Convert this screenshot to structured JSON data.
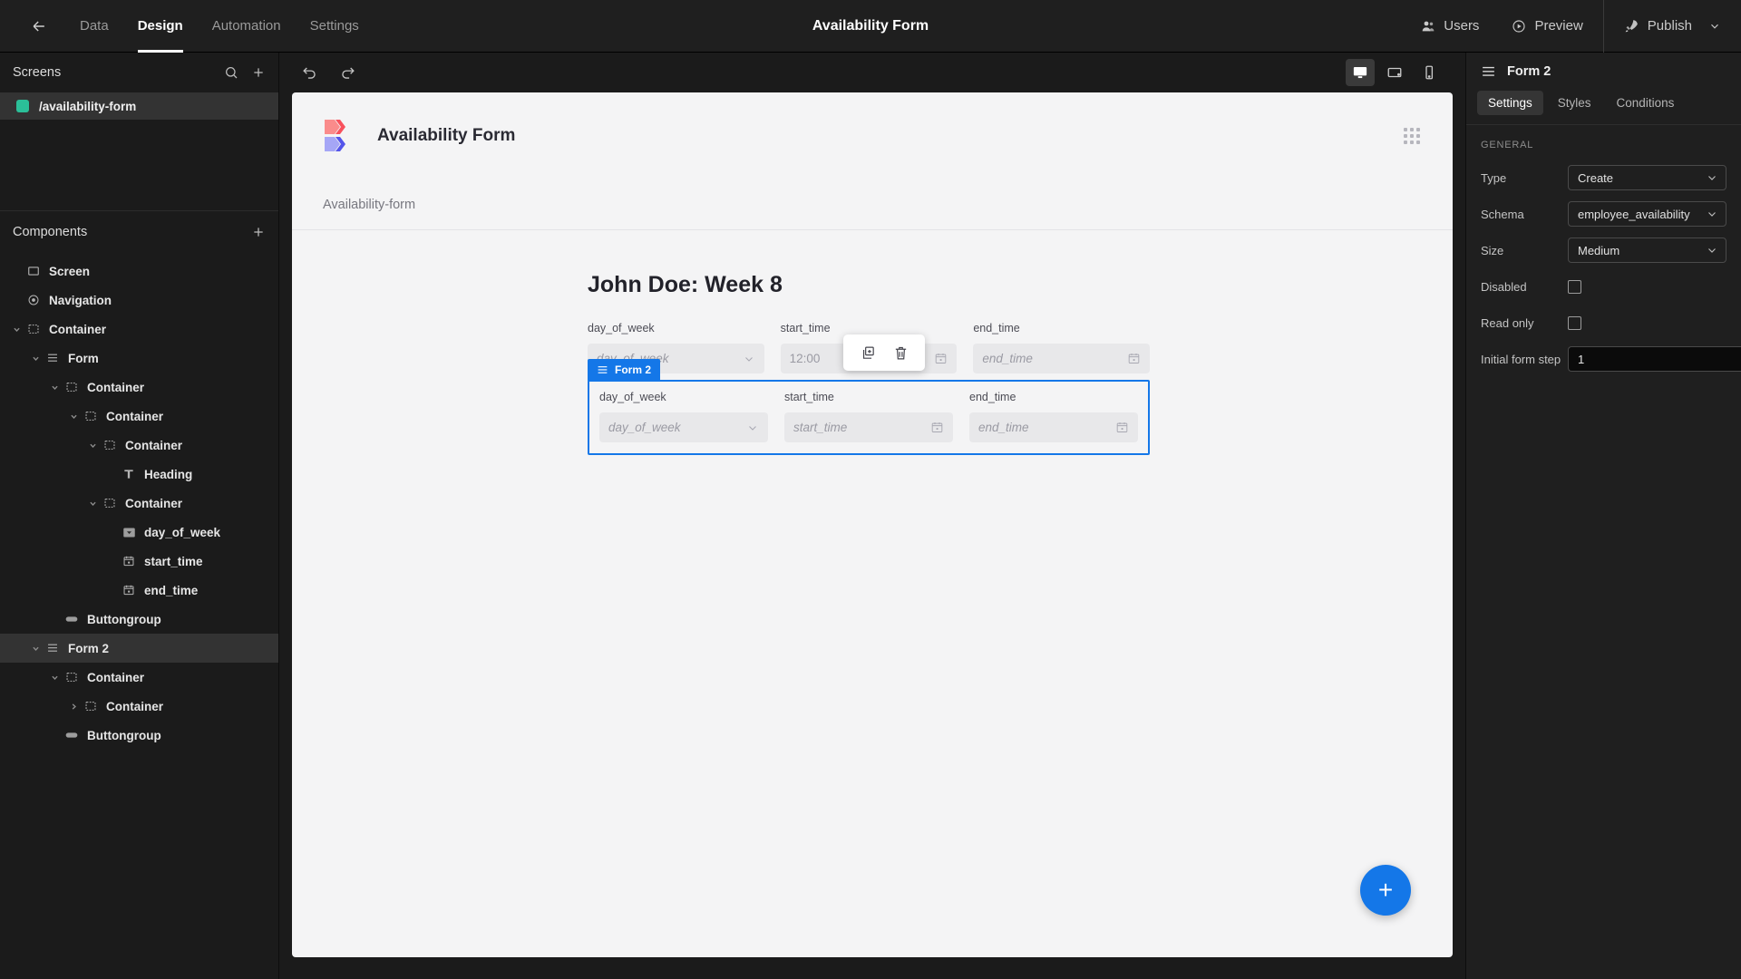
{
  "topbar": {
    "back_icon": "arrow-left-icon",
    "nav_tabs": [
      {
        "label": "Data",
        "active": false
      },
      {
        "label": "Design",
        "active": true
      },
      {
        "label": "Automation",
        "active": false
      },
      {
        "label": "Settings",
        "active": false
      }
    ],
    "title": "Availability Form",
    "users_label": "Users",
    "preview_label": "Preview",
    "publish_label": "Publish"
  },
  "left_panel": {
    "screens": {
      "header": "Screens",
      "search_icon": "search-icon",
      "add_icon": "plus-icon",
      "items": [
        {
          "label": "/availability-form",
          "selected": true,
          "color": "#2bbf98"
        }
      ]
    },
    "components": {
      "header": "Components",
      "add_icon": "plus-icon",
      "tree": [
        {
          "label": "Screen",
          "depth": 0,
          "icon": "screen-icon",
          "caret": "none",
          "selected": false
        },
        {
          "label": "Navigation",
          "depth": 0,
          "icon": "nav-icon",
          "caret": "none",
          "selected": false
        },
        {
          "label": "Container",
          "depth": 0,
          "icon": "container-icon",
          "caret": "expanded",
          "selected": false
        },
        {
          "label": "Form",
          "depth": 1,
          "icon": "form-icon",
          "caret": "expanded",
          "selected": false
        },
        {
          "label": "Container",
          "depth": 2,
          "icon": "container-icon",
          "caret": "expanded",
          "selected": false
        },
        {
          "label": "Container",
          "depth": 3,
          "icon": "container-icon",
          "caret": "expanded",
          "selected": false
        },
        {
          "label": "Container",
          "depth": 4,
          "icon": "container-icon",
          "caret": "expanded",
          "selected": false
        },
        {
          "label": "Heading",
          "depth": 5,
          "icon": "text-icon",
          "caret": "none",
          "selected": false
        },
        {
          "label": "Container",
          "depth": 4,
          "icon": "container-icon",
          "caret": "expanded",
          "selected": false
        },
        {
          "label": "day_of_week",
          "depth": 5,
          "icon": "select-icon",
          "caret": "none",
          "selected": false
        },
        {
          "label": "start_time",
          "depth": 5,
          "icon": "calendar-icon",
          "caret": "none",
          "selected": false
        },
        {
          "label": "end_time",
          "depth": 5,
          "icon": "calendar-icon",
          "caret": "none",
          "selected": false
        },
        {
          "label": "Buttongroup",
          "depth": 2,
          "icon": "button-icon",
          "caret": "none",
          "selected": false
        },
        {
          "label": "Form 2",
          "depth": 1,
          "icon": "form-icon",
          "caret": "expanded",
          "selected": true
        },
        {
          "label": "Container",
          "depth": 2,
          "icon": "container-icon",
          "caret": "expanded",
          "selected": false
        },
        {
          "label": "Container",
          "depth": 3,
          "icon": "container-icon",
          "caret": "collapsed",
          "selected": false
        },
        {
          "label": "Buttongroup",
          "depth": 2,
          "icon": "button-icon",
          "caret": "none",
          "selected": false
        }
      ]
    }
  },
  "canvas": {
    "undo_icon": "undo-icon",
    "redo_icon": "redo-icon",
    "devices": [
      {
        "name": "desktop-view",
        "icon": "desktop-icon",
        "active": true
      },
      {
        "name": "tablet-view",
        "icon": "tablet-icon",
        "active": false
      },
      {
        "name": "mobile-view",
        "icon": "mobile-icon",
        "active": false
      }
    ],
    "app_title": "Availability Form",
    "logo_colors": {
      "top_left": "#fa8b8b",
      "top_right": "#f8515c",
      "bottom_left": "#a5a6f6",
      "bottom_right": "#5455ea"
    },
    "grid_icon": "grid-dots-icon",
    "breadcrumb": "Availability-form",
    "form_heading": "John Doe: Week 8",
    "form1": {
      "fields": [
        {
          "label": "day_of_week",
          "value": "day_of_week",
          "is_placeholder": true,
          "control": "select"
        },
        {
          "label": "start_time",
          "value": "12:00",
          "is_placeholder": false,
          "control": "date"
        },
        {
          "label": "end_time",
          "value": "end_time",
          "is_placeholder": true,
          "control": "date"
        }
      ]
    },
    "form2": {
      "badge_label": "Form 2",
      "badge_icon": "form-icon",
      "badge_color": "#1477e8",
      "fields": [
        {
          "label": "day_of_week",
          "value": "day_of_week",
          "is_placeholder": true,
          "control": "select"
        },
        {
          "label": "start_time",
          "value": "start_time",
          "is_placeholder": true,
          "control": "date"
        },
        {
          "label": "end_time",
          "value": "end_time",
          "is_placeholder": true,
          "control": "date"
        }
      ]
    },
    "float_toolbar": {
      "duplicate_icon": "duplicate-icon",
      "delete_icon": "trash-icon"
    },
    "fab_label": "+"
  },
  "right_panel": {
    "title": "Form 2",
    "menu_icon": "form-icon",
    "tabs": [
      {
        "label": "Settings",
        "active": true
      },
      {
        "label": "Styles",
        "active": false
      },
      {
        "label": "Conditions",
        "active": false
      }
    ],
    "section_title": "GENERAL",
    "properties": [
      {
        "label": "Type",
        "type": "select",
        "value": "Create"
      },
      {
        "label": "Schema",
        "type": "select",
        "value": "employee_availability"
      },
      {
        "label": "Size",
        "type": "select",
        "value": "Medium"
      },
      {
        "label": "Disabled",
        "type": "checkbox",
        "value": false
      },
      {
        "label": "Read only",
        "type": "checkbox",
        "value": false
      },
      {
        "label": "Initial form step",
        "type": "input-bolt",
        "value": "1",
        "bolt_icon": "lightning-icon"
      }
    ]
  }
}
